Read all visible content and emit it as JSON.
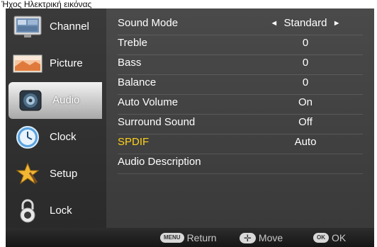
{
  "caption": "Ήχος Ηλεκτρική εικόνας",
  "sidebar": {
    "items": [
      {
        "label": "Channel",
        "icon": "channel-icon",
        "active": false
      },
      {
        "label": "Picture",
        "icon": "picture-icon",
        "active": false
      },
      {
        "label": "Audio",
        "icon": "audio-icon",
        "active": true
      },
      {
        "label": "Clock",
        "icon": "clock-icon",
        "active": false
      },
      {
        "label": "Setup",
        "icon": "setup-icon",
        "active": false
      },
      {
        "label": "Lock",
        "icon": "lock-icon",
        "active": false
      }
    ]
  },
  "menu": {
    "rows": [
      {
        "name": "Sound Mode",
        "value": "Standard",
        "has_arrows": true
      },
      {
        "name": "Treble",
        "value": "0"
      },
      {
        "name": "Bass",
        "value": "0"
      },
      {
        "name": "Balance",
        "value": "0"
      },
      {
        "name": "Auto Volume",
        "value": "On"
      },
      {
        "name": "Surround Sound",
        "value": "Off"
      },
      {
        "name": "SPDIF",
        "value": "Auto",
        "highlighted": true
      },
      {
        "name": "Audio Description",
        "value": ""
      }
    ],
    "arrow_left": "◄",
    "arrow_right": "►",
    "highlight_color": "#ffd11a"
  },
  "footer": {
    "menu_key": "MENU",
    "return_label": "Return",
    "move_key": "✛",
    "move_label": "Move",
    "ok_key": "OK",
    "ok_label": "OK"
  }
}
